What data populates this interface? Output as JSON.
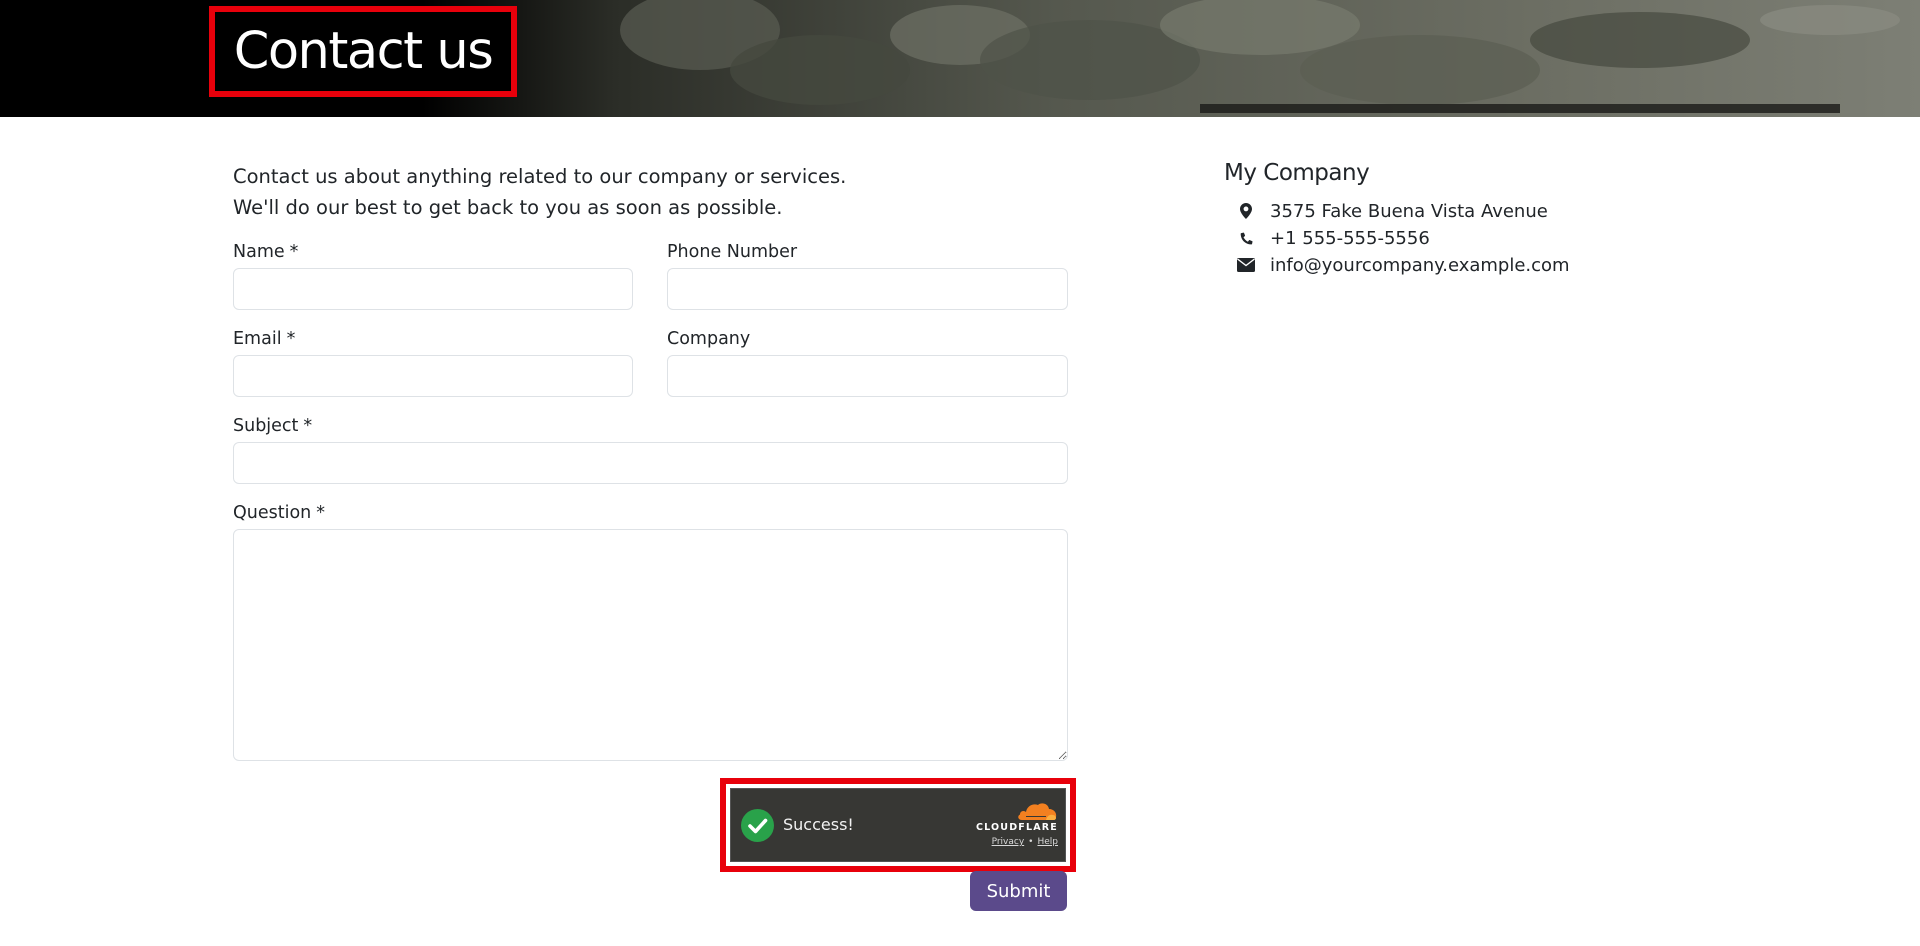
{
  "header": {
    "title": "Contact us"
  },
  "intro": {
    "line1": "Contact us about anything related to our company or services.",
    "line2": "We'll do our best to get back to you as soon as possible."
  },
  "form": {
    "required_mark": "*",
    "name": {
      "label": "Name",
      "value": ""
    },
    "phone": {
      "label": "Phone Number",
      "value": ""
    },
    "email": {
      "label": "Email",
      "value": ""
    },
    "company": {
      "label": "Company",
      "value": ""
    },
    "subject": {
      "label": "Subject",
      "value": ""
    },
    "question": {
      "label": "Question",
      "value": ""
    },
    "submit_label": "Submit"
  },
  "captcha": {
    "status": "Success!",
    "brand": "CLOUDFLARE",
    "privacy_label": "Privacy",
    "separator": "•",
    "help_label": "Help",
    "status_color": "#29a24a",
    "brand_color": "#f38020"
  },
  "company_info": {
    "name": "My Company",
    "address": "3575 Fake Buena Vista Avenue",
    "phone": "+1 555-555-5556",
    "email": "info@yourcompany.example.com",
    "address_icon": "map-marker-icon",
    "phone_icon": "phone-icon",
    "email_icon": "envelope-icon"
  },
  "colors": {
    "primary": "#5b4a8b",
    "highlight": "#e8000b"
  }
}
